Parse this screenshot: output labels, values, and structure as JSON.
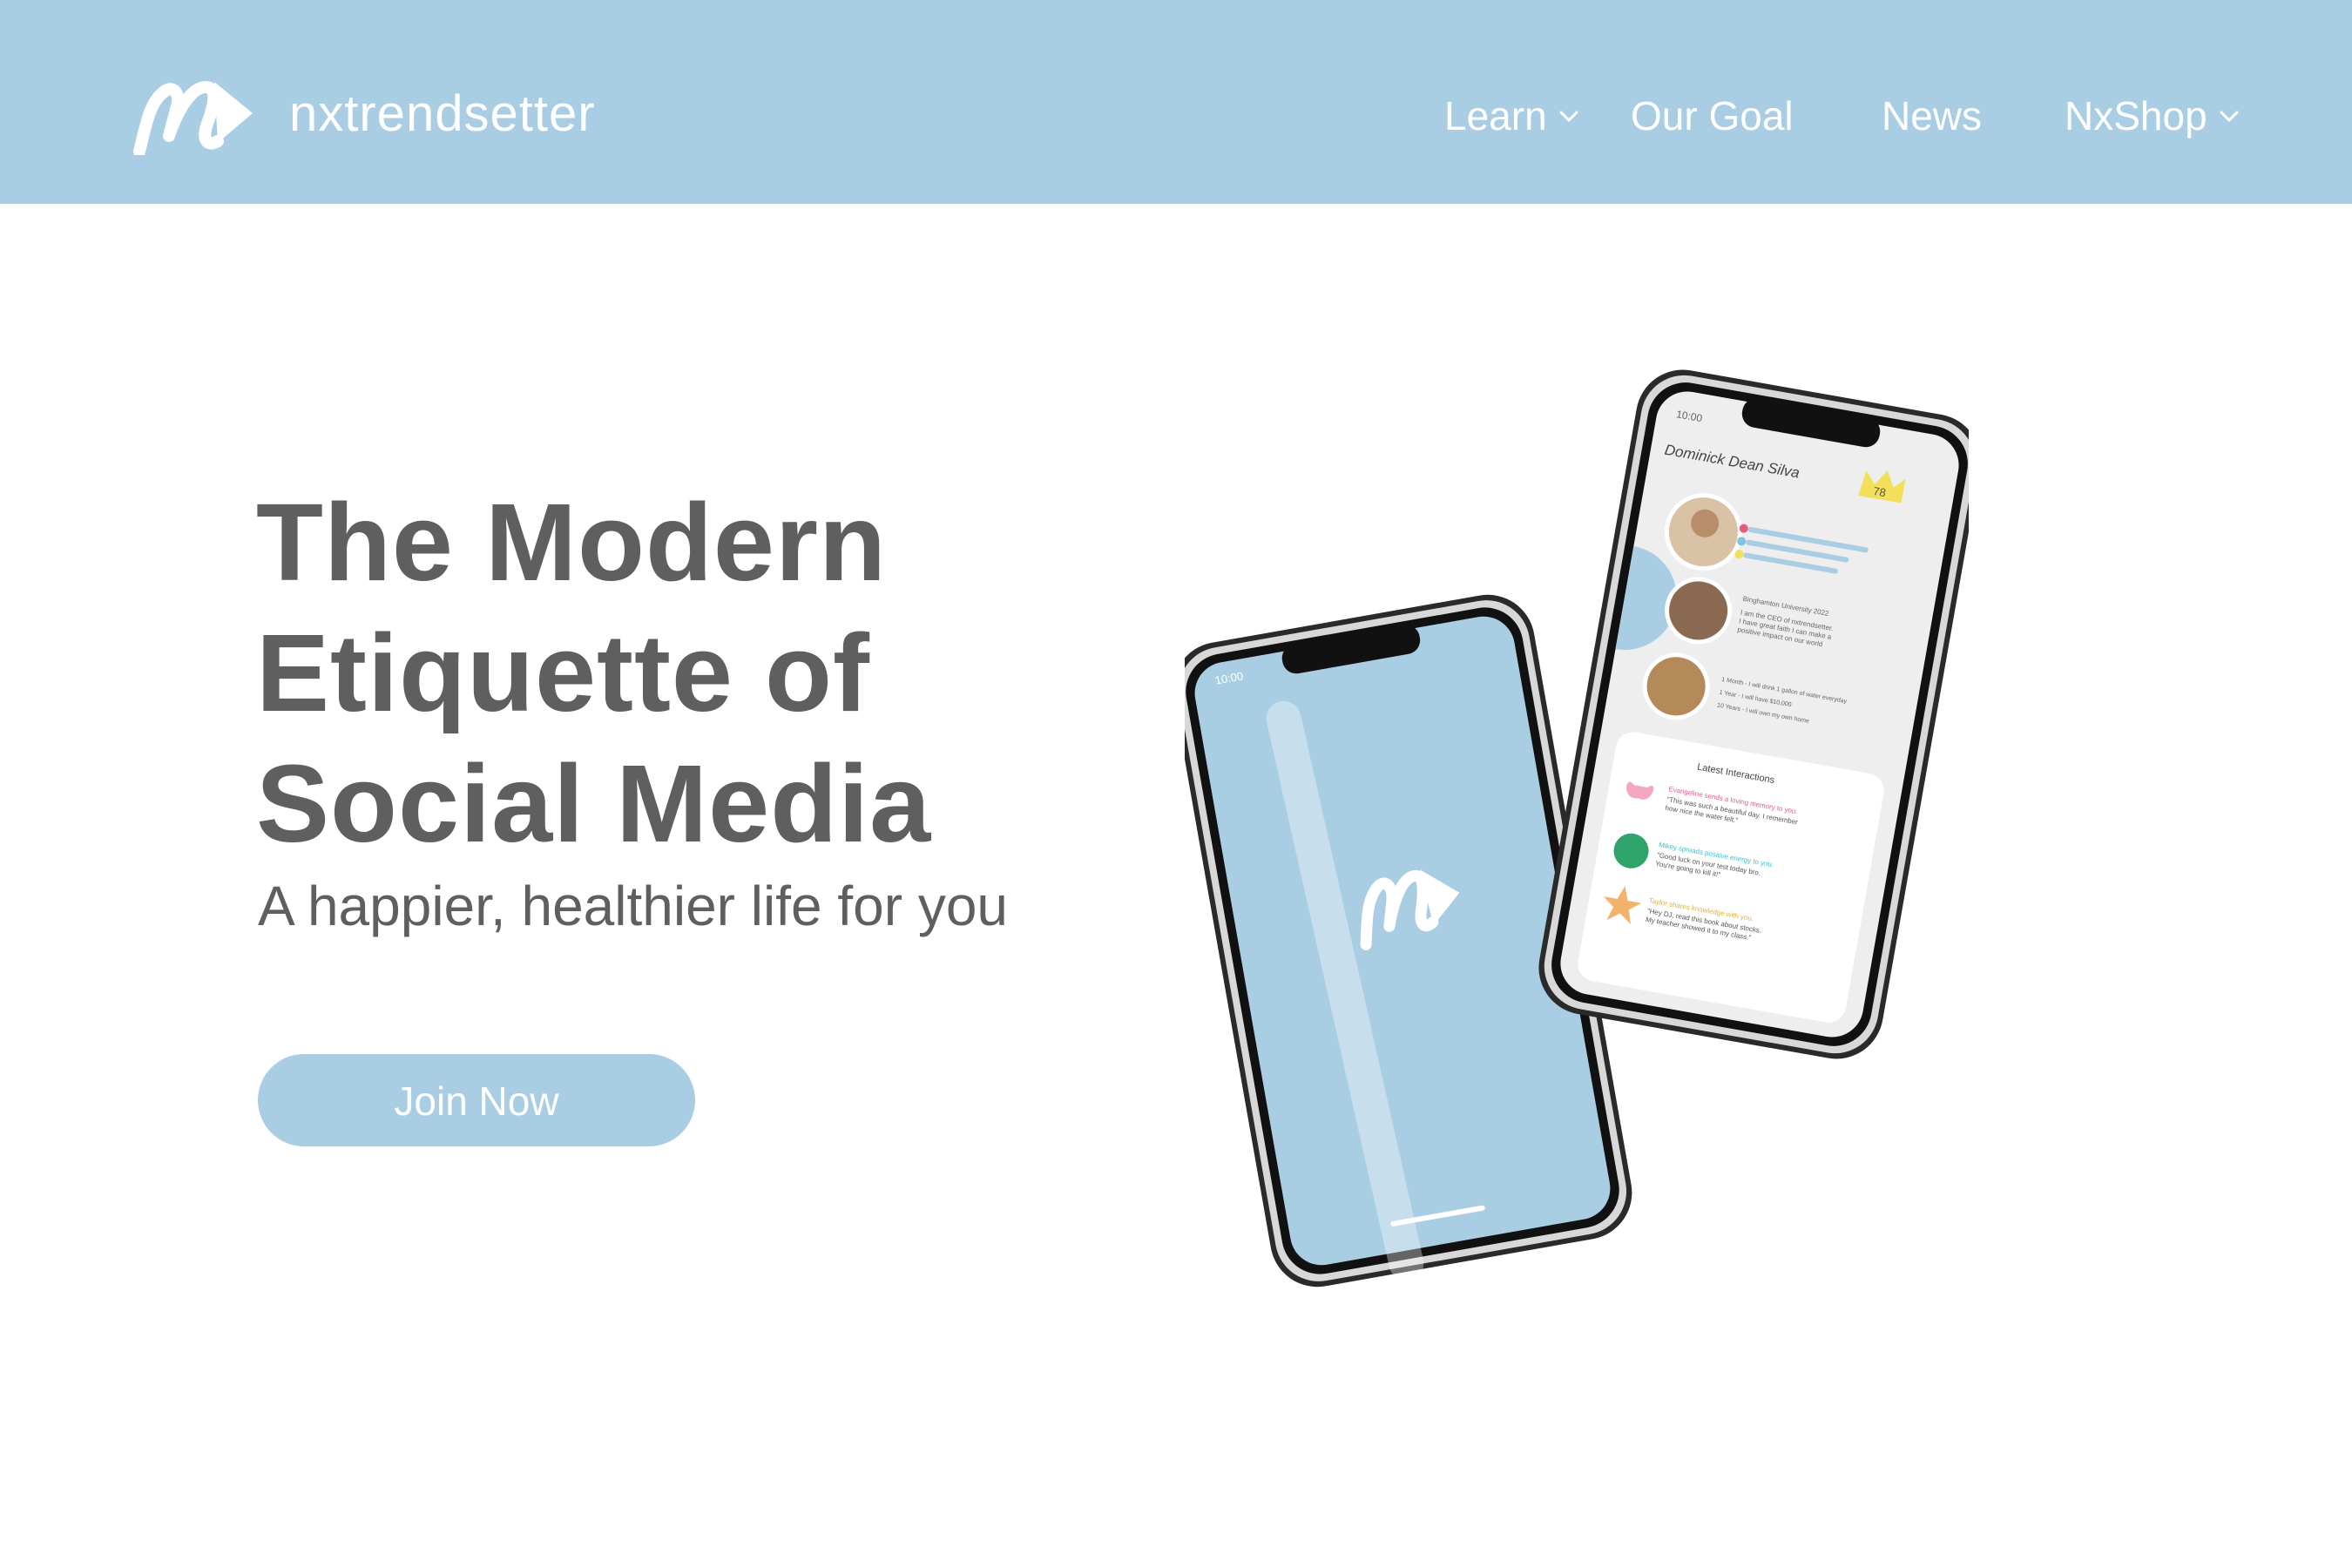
{
  "header": {
    "brand": "nxtrendsetter",
    "nav": [
      {
        "label": "Learn",
        "has_dropdown": true
      },
      {
        "label": "Our Goal",
        "has_dropdown": false
      },
      {
        "label": "News",
        "has_dropdown": false
      },
      {
        "label": "NxShop",
        "has_dropdown": true
      }
    ]
  },
  "hero": {
    "title_lines": [
      "The Modern",
      "Etiquette of",
      "Social Media"
    ],
    "subtitle": "A happier, healthier life for you",
    "cta_label": "Join Now"
  },
  "phone_back": {
    "time": "10:00"
  },
  "phone_front": {
    "time": "10:00",
    "profile_name": "Dominick Dean Silva",
    "score": "78",
    "school": "Binghamton University 2022",
    "bio_lines": [
      "I am the CEO of nxtrendsetter.",
      "I have great faith I can make a",
      "positive impact on our world"
    ],
    "goals": [
      "1 Month - I will drink 1 gallon of water everyday",
      "1 Year - I will have $10,000",
      "10 Years - I will own my own home"
    ],
    "interactions_title": "Latest Interactions",
    "interactions": [
      {
        "headline": "Evangeline sends a loving memory to you.",
        "body_lines": [
          "\"This was such a beautiful day. I remember",
          "how nice the water felt.\""
        ],
        "icon": "butterfly-icon",
        "color": "#e85a8a"
      },
      {
        "headline": "Mikey spreads positive energy to you.",
        "body_lines": [
          "\"Good luck on your test today bro.",
          "You're going to kill it!\""
        ],
        "icon": "basketball-icon",
        "color": "#3bbfd0"
      },
      {
        "headline": "Taylor shares knowledge with you.",
        "body_lines": [
          "\"Hey DJ, read this book about stocks.",
          "My teacher showed it to my class.\""
        ],
        "icon": "star-icon",
        "color": "#e0b23a"
      }
    ]
  },
  "colors": {
    "nav_bg": "#a9cde3",
    "text_gray": "#5f5f5f",
    "button_bg": "#a9cde3",
    "phone_screen_blue": "#a9cde3",
    "crown_yellow": "#f3df5a"
  }
}
